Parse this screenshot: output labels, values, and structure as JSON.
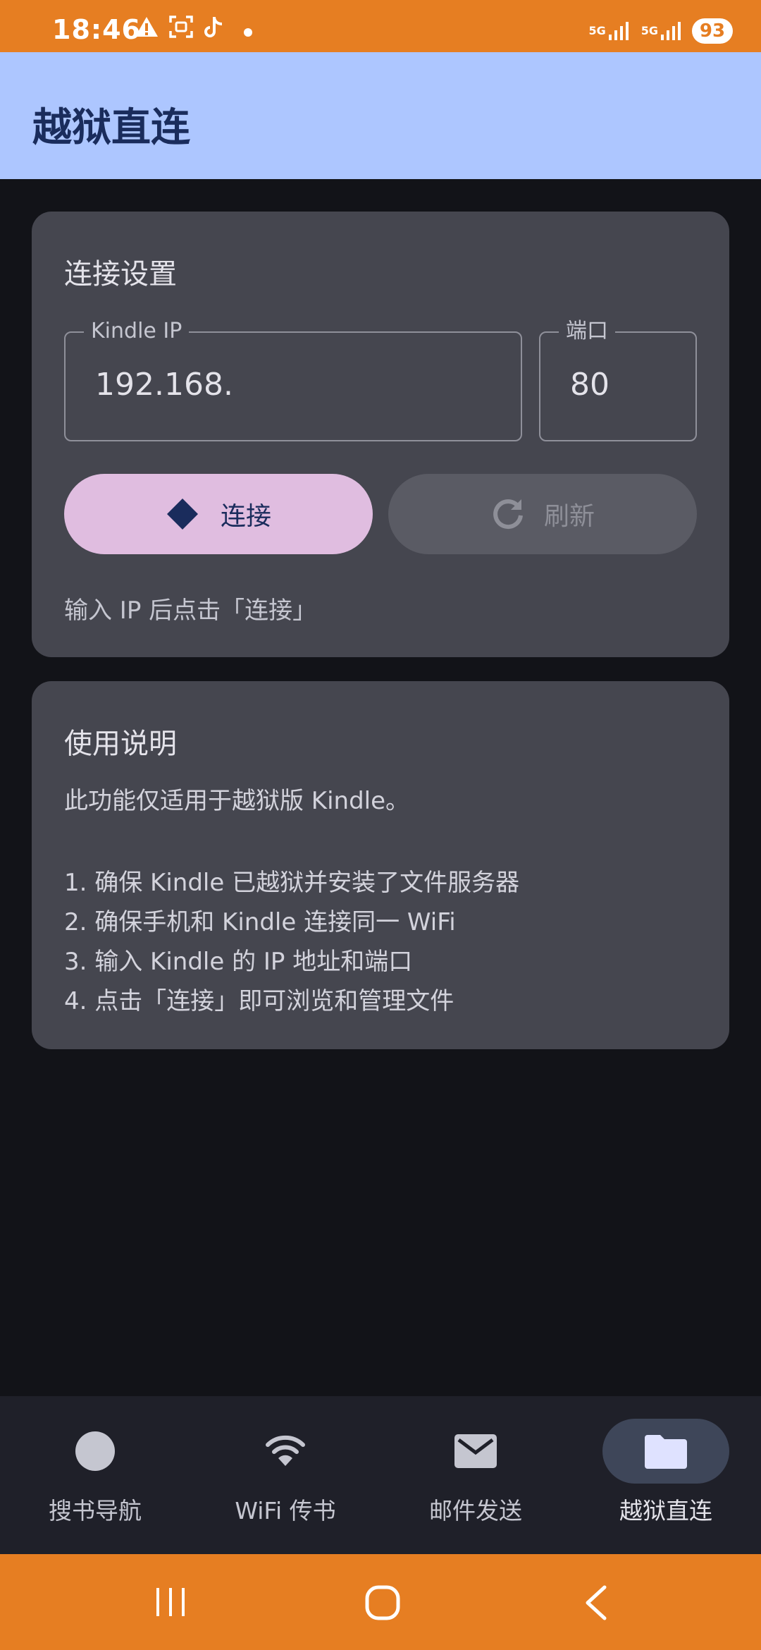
{
  "status_bar": {
    "time": "18:46",
    "network_1": "5G",
    "network_2": "5G",
    "battery": "93",
    "icons": [
      "warning-icon",
      "scan-icon",
      "tiktok-icon",
      "dot-icon",
      "signal-icon",
      "signal-icon"
    ]
  },
  "app_bar": {
    "title": "越狱直连"
  },
  "connection_card": {
    "title": "连接设置",
    "ip_field": {
      "label": "Kindle IP",
      "value": "192.168."
    },
    "port_field": {
      "label": "端口",
      "value": "80"
    },
    "connect_button": {
      "label": "连接",
      "icon": "diamond-icon"
    },
    "refresh_button": {
      "label": "刷新",
      "icon": "refresh-icon",
      "enabled": false
    },
    "hint": "输入 IP 后点击「连接」"
  },
  "instructions_card": {
    "title": "使用说明",
    "intro": "此功能仅适用于越狱版 Kindle。",
    "steps": [
      "1. 确保 Kindle 已越狱并安装了文件服务器",
      "2. 确保手机和 Kindle 连接同一 WiFi",
      "3. 输入 Kindle 的 IP 地址和端口",
      "4. 点击「连接」即可浏览和管理文件"
    ]
  },
  "bottom_nav": {
    "items": [
      {
        "label": "搜书导航",
        "icon": "circle-icon",
        "selected": false
      },
      {
        "label": "WiFi 传书",
        "icon": "wifi-icon",
        "selected": false
      },
      {
        "label": "邮件发送",
        "icon": "mail-icon",
        "selected": false
      },
      {
        "label": "越狱直连",
        "icon": "folder-icon",
        "selected": true
      }
    ]
  },
  "colors": {
    "status_bar": "#e67e22",
    "app_bar": "#adc6ff",
    "background": "#121318",
    "card": "#45464f",
    "connect_button": "#e0bde0",
    "selected_nav_pill": "#3e4659"
  }
}
